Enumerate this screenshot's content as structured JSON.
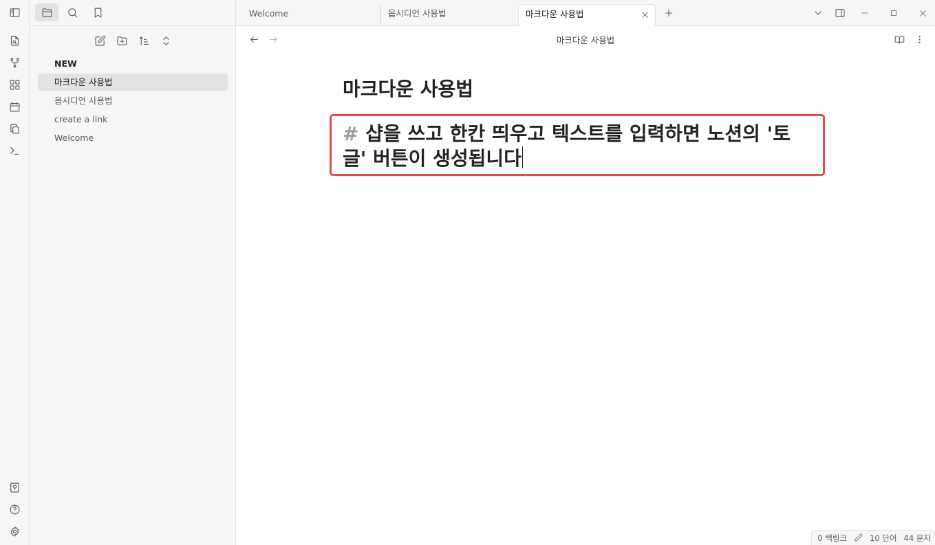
{
  "sidebar": {
    "tabs": [
      {
        "icon": "folder-icon",
        "label": "Files"
      },
      {
        "icon": "search-icon",
        "label": "Search"
      },
      {
        "icon": "bookmark-icon",
        "label": "Bookmarks"
      }
    ],
    "files": [
      {
        "label": "NEW",
        "type": "folder"
      },
      {
        "label": "마크다운 사용법",
        "type": "file",
        "active": true
      },
      {
        "label": "옵시디언 사용법",
        "type": "file"
      },
      {
        "label": "create a link",
        "type": "file"
      },
      {
        "label": "Welcome",
        "type": "file"
      }
    ]
  },
  "tabs": [
    {
      "label": "Welcome"
    },
    {
      "label": "옵시디언 사용법"
    },
    {
      "label": "마크다운 사용법",
      "active": true
    }
  ],
  "editor": {
    "view_title": "마크다운 사용법",
    "doc_title": "마크다운 사용법",
    "heading_marker": "#",
    "heading_text": "샵을 쓰고 한칸 띄우고 텍스트를 입력하면 노션의 '토글' 버튼이 생성됩니다"
  },
  "statusbar": {
    "backlinks": "0 백링크",
    "words": "10 단어",
    "chars": "44 문자"
  },
  "colors": {
    "highlight_border": "#e5484d",
    "panel_bg": "#f6f6f6",
    "active_item_bg": "#e3e3e3"
  }
}
